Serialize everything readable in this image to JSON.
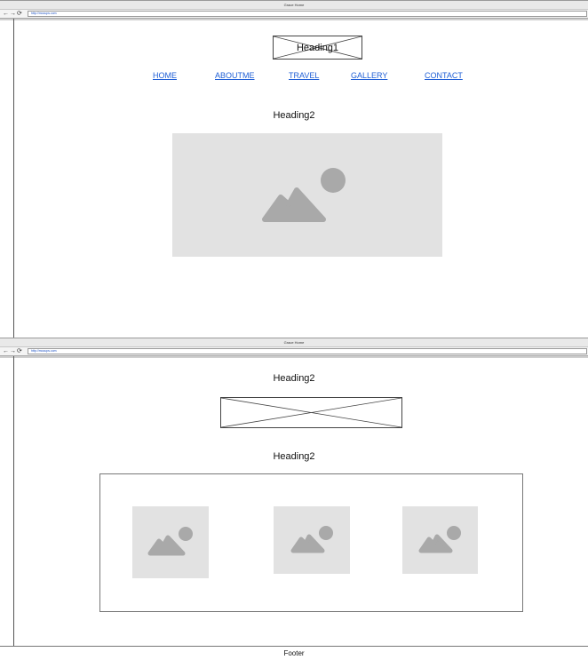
{
  "browser": {
    "window_title": "Grace Home",
    "back_icon": "arrow-left-icon",
    "forward_icon": "arrow-right-icon",
    "reload_icon": "reload-icon",
    "url": "http://mocups.com"
  },
  "page1": {
    "heading1": "Heading1",
    "nav": [
      "HOME",
      "ABOUTME",
      "TRAVEL",
      "GALLERY",
      "CONTACT"
    ],
    "heading2": "Heading2",
    "hero_image_icon": "image-placeholder-icon"
  },
  "page2": {
    "heading2_top": "Heading2",
    "heading2_gallery": "Heading2",
    "gallery_images": [
      "image-placeholder-icon",
      "image-placeholder-icon",
      "image-placeholder-icon"
    ]
  },
  "footer": {
    "label": "Footer"
  },
  "colors": {
    "link": "#1f5fd6",
    "placeholder_bg": "#e2e2e2",
    "placeholder_icon": "#a9a9a9"
  }
}
